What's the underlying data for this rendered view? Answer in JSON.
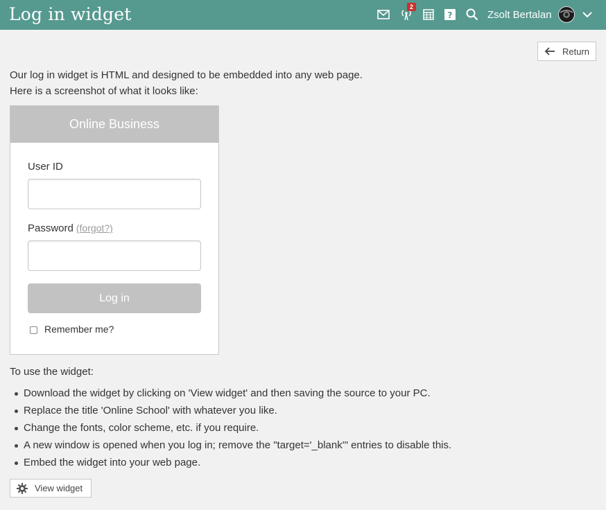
{
  "header": {
    "title": "Log in widget",
    "notification_count": "2",
    "user_name": "Zsolt Bertalan",
    "icons": [
      "mail-icon",
      "broadcast-icon",
      "calendar-icon",
      "help-icon",
      "search-icon",
      "chevron-down-icon"
    ],
    "bg_color": "#55998f"
  },
  "toolbar": {
    "return_label": "Return"
  },
  "intro": {
    "line1": "Our log in widget is HTML and designed to be embedded into any web page.",
    "line2": "Here is a screenshot of what it looks like:"
  },
  "widget": {
    "title": "Online Business",
    "user_id_label": "User ID",
    "password_label": "Password",
    "forgot_label": "(forgot?)",
    "login_label": "Log in",
    "remember_label": "Remember me?"
  },
  "instructions": {
    "heading": "To use the widget:",
    "steps": [
      "Download the widget by clicking on 'View widget' and then saving the source to your PC.",
      "Replace the title 'Online School' with whatever you like.",
      "Change the fonts, color scheme, etc. if you require.",
      "A new window is opened when you log in; remove the \"target='_blank'\" entries to disable this.",
      "Embed the widget into your web page."
    ]
  },
  "footer": {
    "view_widget_label": "View widget"
  }
}
